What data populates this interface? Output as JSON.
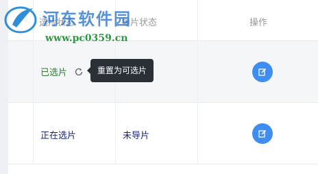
{
  "watermark": {
    "site_name": "河东软件园",
    "url": "www.pc0359.cn"
  },
  "table": {
    "columns": [
      {
        "key": "select_status",
        "label": "选片状态"
      },
      {
        "key": "guide_status",
        "label": "导片状态"
      },
      {
        "key": "actions",
        "label": "操作"
      }
    ],
    "rows": [
      {
        "select_status": "已选片",
        "guide_status": "",
        "action_icon": "edit-icon"
      },
      {
        "select_status": "正在选片",
        "guide_status": "未导片",
        "action_icon": "edit-icon"
      }
    ]
  },
  "tooltip": {
    "text": "重置为可选片"
  },
  "colors": {
    "edit_button": "#3d8ef0",
    "status_selected": "#2e7d32",
    "status_selecting": "#1a237e",
    "tooltip_bg": "#2b2f36"
  }
}
